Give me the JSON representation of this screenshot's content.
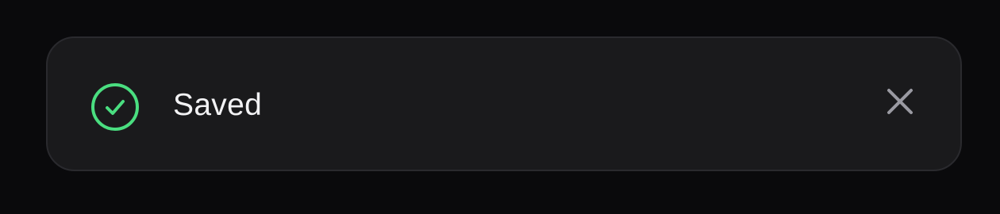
{
  "toast": {
    "message": "Saved",
    "status_icon": "check-circle-icon",
    "close_icon": "close-icon"
  },
  "colors": {
    "background": "#0a0a0c",
    "surface": "#1a1a1c",
    "border": "#2a2a2e",
    "success": "#4ade80",
    "text": "#f2f2f4",
    "muted": "#9a9aa2"
  }
}
